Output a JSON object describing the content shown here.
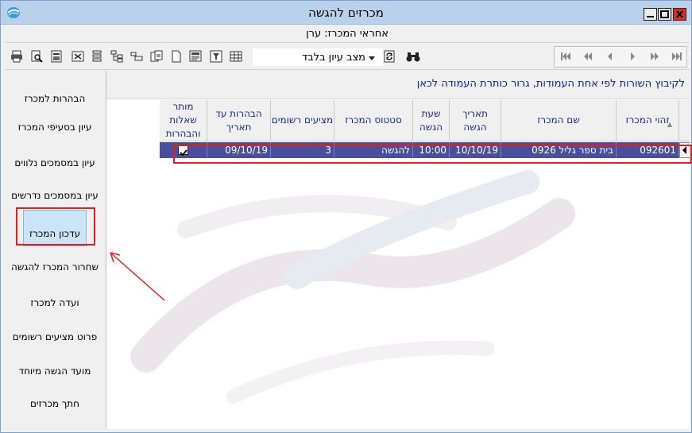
{
  "window": {
    "title": "מכרזים להגשה",
    "subtitle": "אחראי המכרז: ערן"
  },
  "toolbar": {
    "view_select": "מצב עיון בלבד"
  },
  "hint": "לקיבוץ השורות לפי אחת העמודות, גרור כותרת העמודה לכאן",
  "sidebar": {
    "items": [
      {
        "label": "הבהרות למכרז"
      },
      {
        "label": "עיון בסעיפי המכרז"
      },
      {
        "label": "עיון במסמכים נלווים"
      },
      {
        "label": "עיון במסמכים נדרשים"
      },
      {
        "label": "עדכון המכרז"
      },
      {
        "label": "שחרור המכרז להגשה"
      },
      {
        "label": "ועדה למכרז"
      },
      {
        "label": "פרוט מציעים רשומים"
      },
      {
        "label": "מועד הגשה מיוחד"
      },
      {
        "label": "חתך מכרזים"
      }
    ]
  },
  "table": {
    "columns": [
      {
        "label": "זהוי המכרז"
      },
      {
        "label": "שם המכרז"
      },
      {
        "label": "תאריך הגשה"
      },
      {
        "label": "שעת הגשה"
      },
      {
        "label": "סטטוס המכרז"
      },
      {
        "label": "מציעים רשומים"
      },
      {
        "label": "הבהרות עד תאריך"
      },
      {
        "label": "מותר שאלות והבהרות"
      }
    ],
    "rows": [
      {
        "id": "092601",
        "name": "בית ספר גליל 0926",
        "date": "10/10/19",
        "time": "10:00",
        "status": "להגשה",
        "bidders": "3",
        "clarify_until": "09/10/19",
        "allow_questions": true
      }
    ]
  },
  "colors": {
    "row_selected": "#4a4f9c",
    "header_text": "#1a2a8a",
    "hint_text": "#0b1f9a",
    "annotation": "#e02020"
  }
}
